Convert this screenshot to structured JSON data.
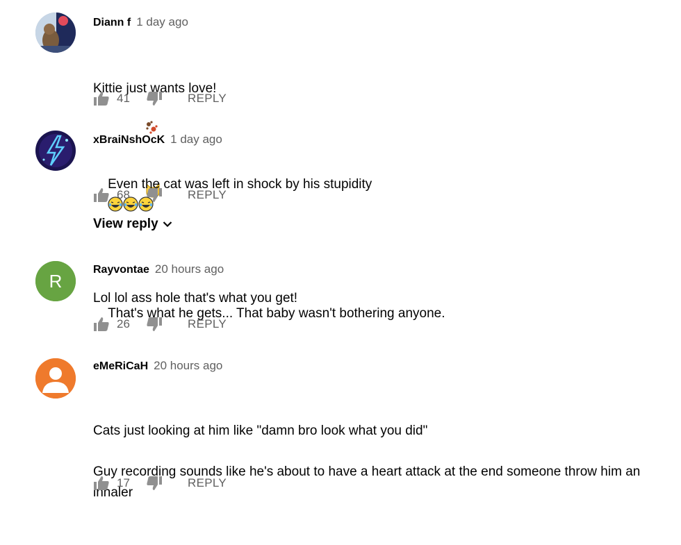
{
  "comments": [
    {
      "author": "Diann f",
      "time": "1 day ago",
      "lines": [
        "Kittie just wants love!",
        "Lol lol ass hole that's what you get!"
      ],
      "likes": "41",
      "reply_label": "REPLY"
    },
    {
      "author": "xBraiNshOcK",
      "time": "1 day ago",
      "lines": [
        "Even the cat was left in shock by his stupidity"
      ],
      "likes": "68",
      "reply_label": "REPLY",
      "view_reply_label": "View reply"
    },
    {
      "author": "Rayvontae",
      "time": "20 hours ago",
      "avatar_letter": "R",
      "avatar_color": "#67a442",
      "lines": [
        "That's what he gets... That baby wasn't bothering anyone."
      ],
      "likes": "26",
      "reply_label": "REPLY"
    },
    {
      "author": "eMeRiCaH",
      "time": "20 hours ago",
      "avatar_color": "#ef7a2c",
      "lines": [
        "Cats just looking at him like \"damn bro look what you did\"",
        "Guy recording sounds like he's about to have a heart attack at the end someone throw him an inhaler"
      ],
      "likes": "17",
      "reply_label": "REPLY"
    }
  ],
  "icons": {
    "like": "thumbs-up-icon",
    "dislike": "thumbs-down-icon",
    "expand": "chevron-down-icon"
  },
  "colors": {
    "icon_gray": "#909090",
    "meta_gray": "#606060"
  }
}
